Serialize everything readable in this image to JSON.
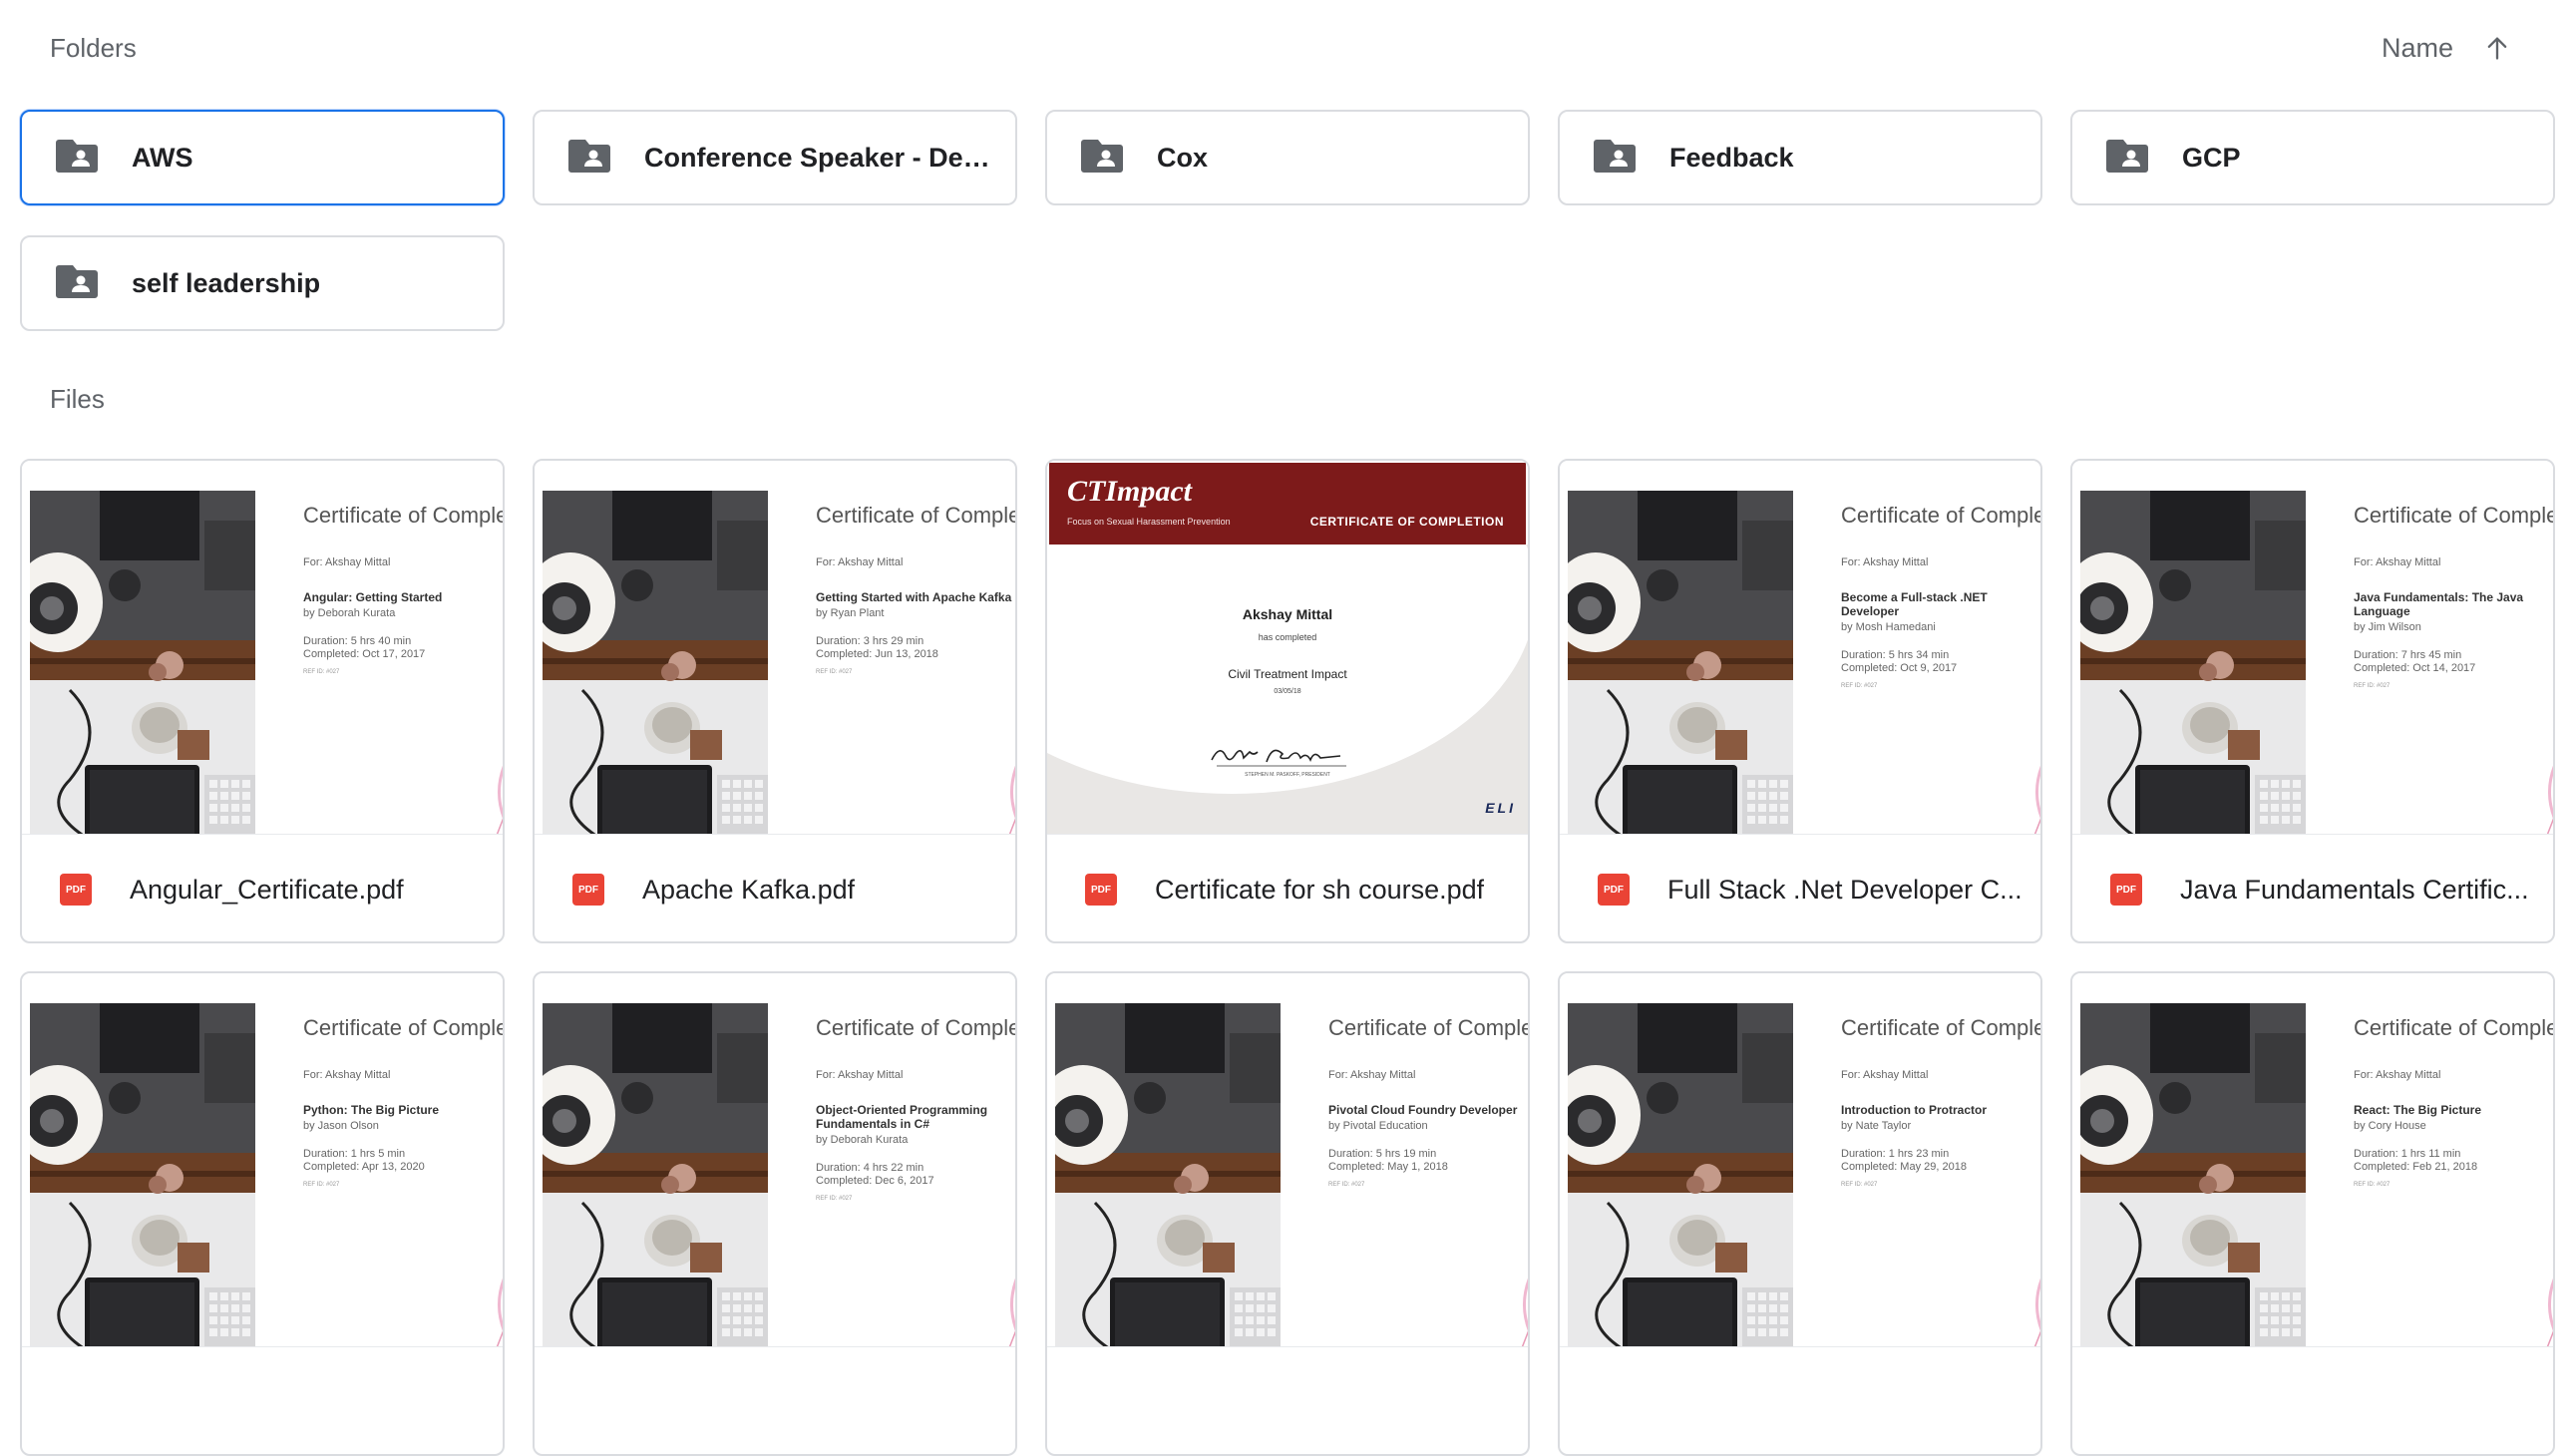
{
  "folders_section": {
    "label": "Folders",
    "sort_label": "Name",
    "sort_icon": "arrow-up-icon",
    "items": [
      {
        "name": "AWS",
        "selected": true
      },
      {
        "name": "Conference Speaker - Devel..."
      },
      {
        "name": "Cox"
      },
      {
        "name": "Feedback"
      },
      {
        "name": "GCP"
      },
      {
        "name": "self leadership"
      }
    ]
  },
  "files_section": {
    "label": "Files",
    "file_icon": "pdf-icon",
    "pdf_badge": "PDF",
    "items": [
      {
        "name": "Angular_Certificate.pdf",
        "preview": {
          "title": "Certificate of Completion",
          "for": "For: Akshay Mittal",
          "course": "Angular: Getting Started",
          "author": "by Deborah Kurata",
          "duration": "Duration: 5 hrs 40 min",
          "completed": "Completed: Oct 17, 2017",
          "ref": "REF ID: #027"
        }
      },
      {
        "name": "Apache Kafka.pdf",
        "preview": {
          "title": "Certificate of Completion",
          "for": "For: Akshay Mittal",
          "course": "Getting Started with Apache Kafka",
          "author": "by Ryan Plant",
          "duration": "Duration: 3 hrs 29 min",
          "completed": "Completed: Jun 13, 2018",
          "ref": "REF ID: #027"
        }
      },
      {
        "name": "Certificate for sh course.pdf",
        "ct_preview": {
          "logo": "CTImpact",
          "subtitle": "Focus on Sexual Harassment Prevention",
          "header": "CERTIFICATE OF COMPLETION",
          "recipient": "Akshay Mittal",
          "has_completed": "has completed",
          "course": "Civil Treatment Impact",
          "date": "03/05/18",
          "signer": "STEPHEN M. PASKOFF, PRESIDENT",
          "brand": "ELI"
        }
      },
      {
        "name": "Full Stack .Net Developer C...",
        "preview": {
          "title": "Certificate of Completion",
          "for": "For: Akshay Mittal",
          "course": "Become a Full-stack .NET Developer",
          "author": "by Mosh Hamedani",
          "duration": "Duration: 5 hrs 34 min",
          "completed": "Completed: Oct 9, 2017",
          "ref": "REF ID: #027"
        }
      },
      {
        "name": "Java Fundamentals Certific...",
        "preview": {
          "title": "Certificate of Completion",
          "for": "For: Akshay Mittal",
          "course": "Java Fundamentals: The Java Language",
          "author": "by Jim Wilson",
          "duration": "Duration: 7 hrs 45 min",
          "completed": "Completed: Oct 14, 2017",
          "ref": "REF ID: #027"
        }
      },
      {
        "name": "",
        "preview": {
          "title": "Certificate of Completion",
          "for": "For: Akshay Mittal",
          "course": "Python: The Big Picture",
          "author": "by Jason Olson",
          "duration": "Duration: 1 hrs 5 min",
          "completed": "Completed: Apr 13, 2020",
          "ref": "REF ID: #027"
        }
      },
      {
        "name": "",
        "preview": {
          "title": "Certificate of Completion",
          "for": "For: Akshay Mittal",
          "course": "Object-Oriented Programming Fundamentals in C#",
          "author": "by Deborah Kurata",
          "duration": "Duration: 4 hrs 22 min",
          "completed": "Completed: Dec 6, 2017",
          "ref": "REF ID: #027"
        }
      },
      {
        "name": "",
        "preview": {
          "title": "Certificate of Completion",
          "for": "For: Akshay Mittal",
          "course": "Pivotal Cloud Foundry Developer",
          "author": "by Pivotal Education",
          "duration": "Duration: 5 hrs 19 min",
          "completed": "Completed: May 1, 2018",
          "ref": "REF ID: #027"
        }
      },
      {
        "name": "",
        "preview": {
          "title": "Certificate of Completion",
          "for": "For: Akshay Mittal",
          "course": "Introduction to Protractor",
          "author": "by Nate Taylor",
          "duration": "Duration: 1 hrs 23 min",
          "completed": "Completed: May 29, 2018",
          "ref": "REF ID: #027"
        }
      },
      {
        "name": "",
        "preview": {
          "title": "Certificate of Completion",
          "for": "For: Akshay Mittal",
          "course": "React: The Big Picture",
          "author": "by Cory House",
          "duration": "Duration: 1 hrs 11 min",
          "completed": "Completed: Feb 21, 2018",
          "ref": "REF ID: #027"
        }
      }
    ]
  },
  "colors": {
    "selected_border": "#1a73e8",
    "pdf_red": "#ea4335",
    "ct_maroon": "#7d1a1a",
    "folder_icon": "#5f6368"
  }
}
